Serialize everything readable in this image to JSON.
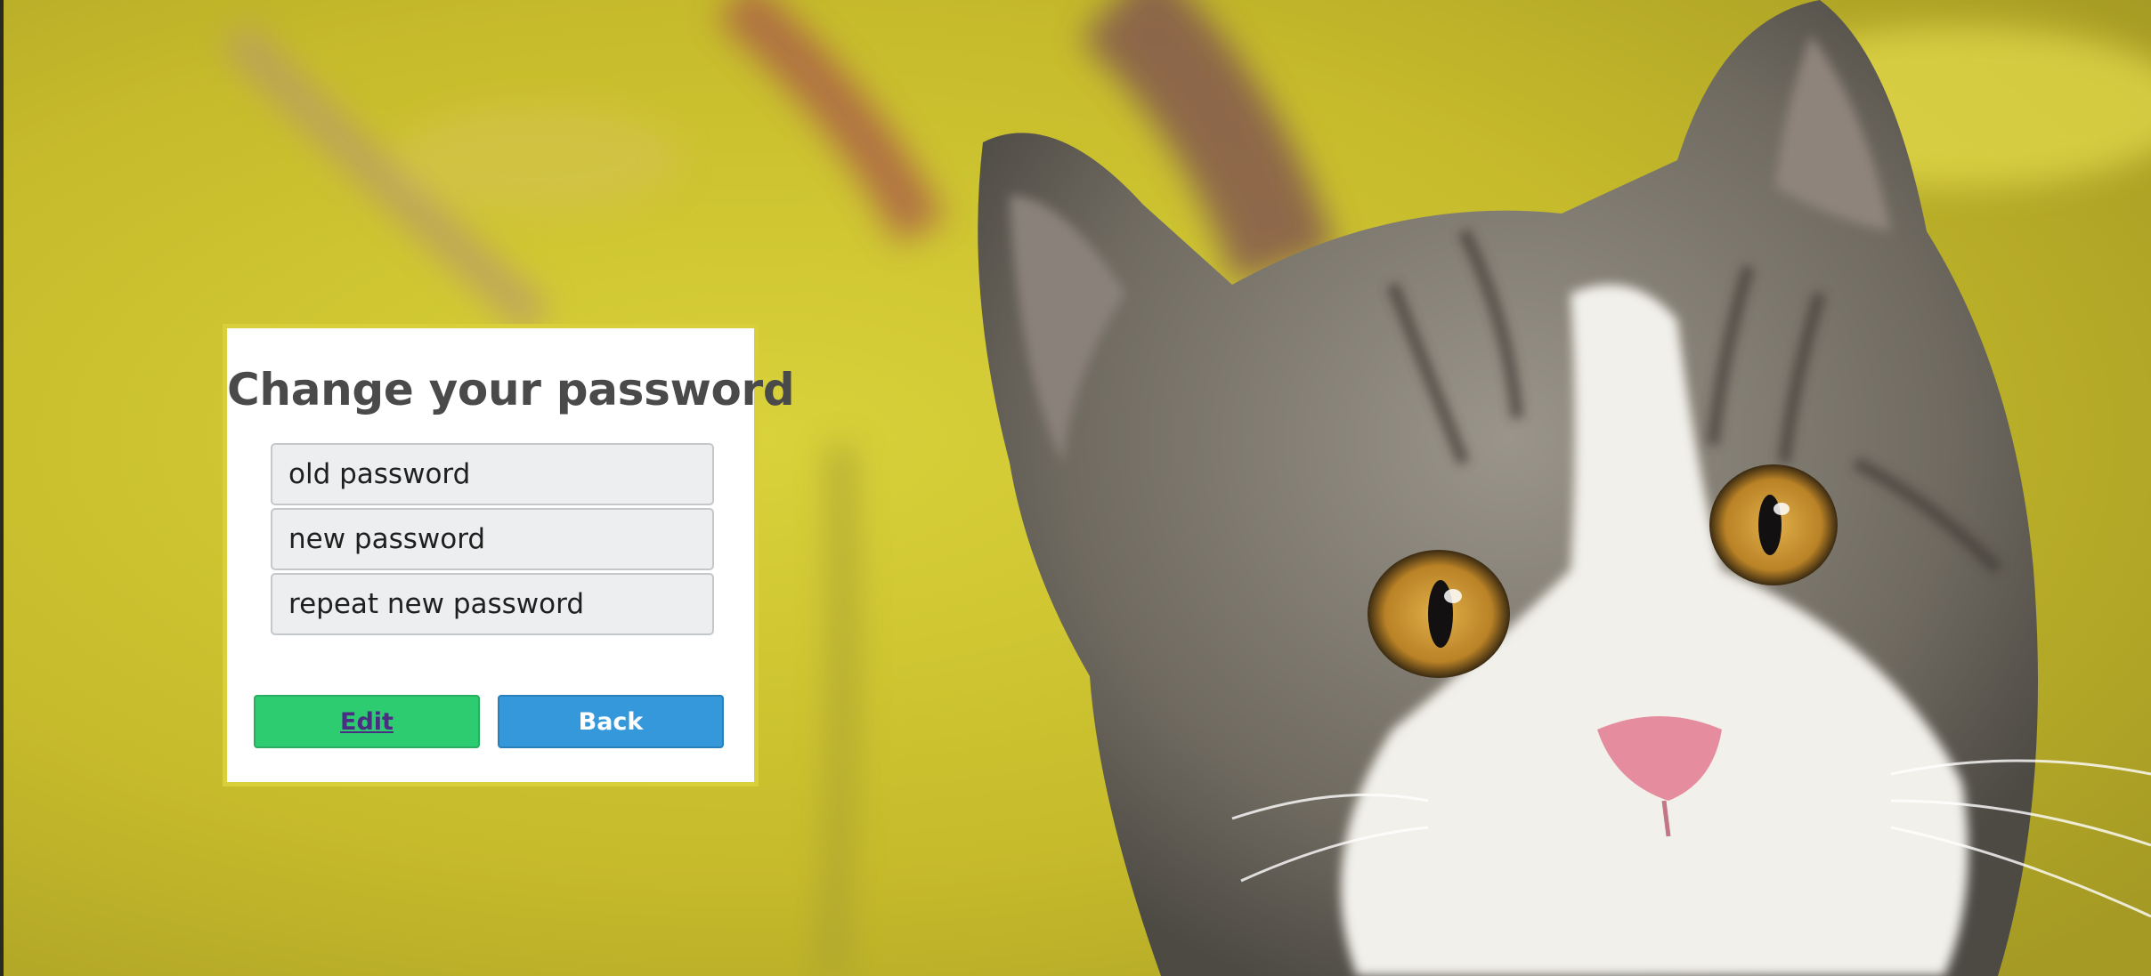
{
  "page": {
    "background_description_color": "#c9bf2a"
  },
  "form": {
    "title": "Change your password",
    "old_password_placeholder": "old password",
    "new_password_placeholder": "new password",
    "repeat_password_placeholder": "repeat new password",
    "edit_label": "Edit",
    "back_label": "Back"
  },
  "colors": {
    "edit_button": "#2ecc71",
    "back_button": "#3498db",
    "card_border": "#d8cf3a"
  }
}
